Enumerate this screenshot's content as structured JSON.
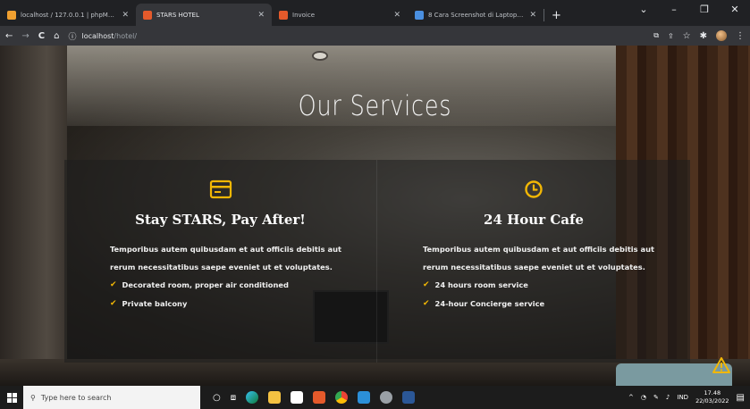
{
  "browser": {
    "tabs": [
      {
        "title": "localhost / 127.0.0.1 | phpMyAdmin",
        "favicon_color": "#f0a030",
        "active": false
      },
      {
        "title": "STARS HOTEL",
        "favicon_color": "#e55a2b",
        "active": true
      },
      {
        "title": "Invoice",
        "favicon_color": "#e55a2b",
        "active": false
      },
      {
        "title": "8 Cara Screenshot di Laptop Windows",
        "favicon_color": "#4a8fe0",
        "active": false
      }
    ],
    "new_tab": "+",
    "window_controls": {
      "chevron": "⌄",
      "minimize": "–",
      "maximize": "❐",
      "close": "✕"
    },
    "address": {
      "host": "localhost",
      "path": "/hotel/"
    },
    "nav": {
      "back": "←",
      "forward": "→",
      "reload": "C",
      "home": "⌂",
      "info": "ⓘ"
    },
    "toolbar_icons": {
      "translate": "⧉",
      "share": "⇪",
      "bookmark": "☆",
      "extensions": "✱",
      "menu": "⋮"
    }
  },
  "page": {
    "heading": "Our Services",
    "services": [
      {
        "icon": "credit-card-icon",
        "title": "Stay STARS, Pay After!",
        "description": "Temporibus autem quibusdam et aut officiis debitis aut rerum necessitatibus saepe eveniet ut et voluptates.",
        "features": [
          "Decorated room, proper air conditioned",
          "Private balcony"
        ]
      },
      {
        "icon": "clock-icon",
        "title": "24 Hour Cafe",
        "description": "Temporibus autem quibusdam et aut officiis debitis aut rerum necessitatibus saepe eveniet ut et voluptates.",
        "features": [
          "24 hours room service",
          "24-hour Concierge service"
        ]
      }
    ],
    "accent_color": "#f2b705"
  },
  "taskbar": {
    "search_placeholder": "Type here to search",
    "apps": [
      "task-view",
      "edge",
      "file-explorer",
      "mail",
      "office",
      "chrome",
      "vscode",
      "settings",
      "word"
    ],
    "tray": {
      "chevron": "^",
      "lang": "IND",
      "time": "17.48",
      "date": "22/03/2022"
    }
  }
}
